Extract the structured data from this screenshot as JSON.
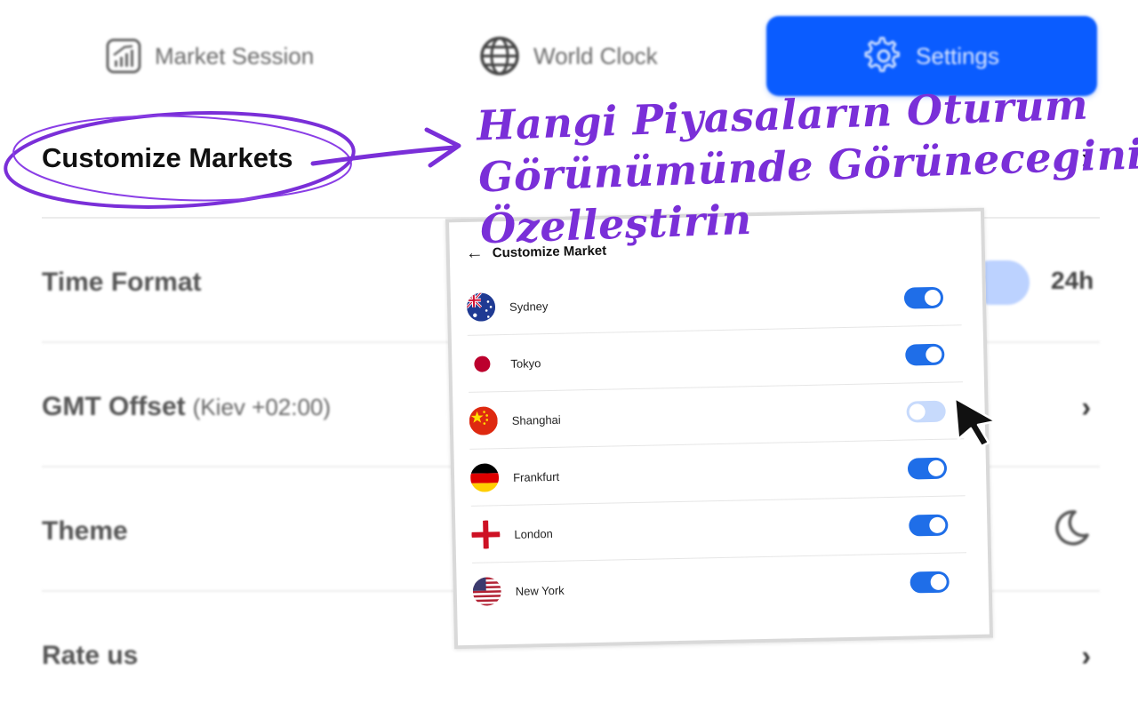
{
  "tabs": [
    {
      "label": "Market Session",
      "icon": "chart-icon"
    },
    {
      "label": "World Clock",
      "icon": "globe-icon"
    },
    {
      "label": "Settings",
      "icon": "gear-icon",
      "active": true
    }
  ],
  "settings": {
    "customize_markets": "Customize Markets",
    "time_format": "Time Format",
    "time_format_value": "24h",
    "gmt_offset": "GMT Offset",
    "gmt_offset_value": "(Kiev +02:00)",
    "theme": "Theme",
    "theme_icon": "moon-icon",
    "rate_us": "Rate us"
  },
  "annotation": {
    "line1": "Hangi Piyasaların Oturum",
    "line2": "Görünümünde Görünecegini",
    "line3": "Özelleştirin",
    "color": "#7a2fd8"
  },
  "customize_market": {
    "title": "Customize Market",
    "markets": [
      {
        "city": "Sydney",
        "flag": "australia-flag-icon",
        "enabled": true
      },
      {
        "city": "Tokyo",
        "flag": "japan-flag-icon",
        "enabled": true
      },
      {
        "city": "Shanghai",
        "flag": "china-flag-icon",
        "enabled": false
      },
      {
        "city": "Frankfurt",
        "flag": "germany-flag-icon",
        "enabled": true
      },
      {
        "city": "London",
        "flag": "england-flag-icon",
        "enabled": true
      },
      {
        "city": "New York",
        "flag": "usa-flag-icon",
        "enabled": true
      }
    ]
  },
  "colors": {
    "accent": "#0a5cff",
    "toggle_on": "#1f6ee8",
    "toggle_off": "#c7dafc"
  }
}
